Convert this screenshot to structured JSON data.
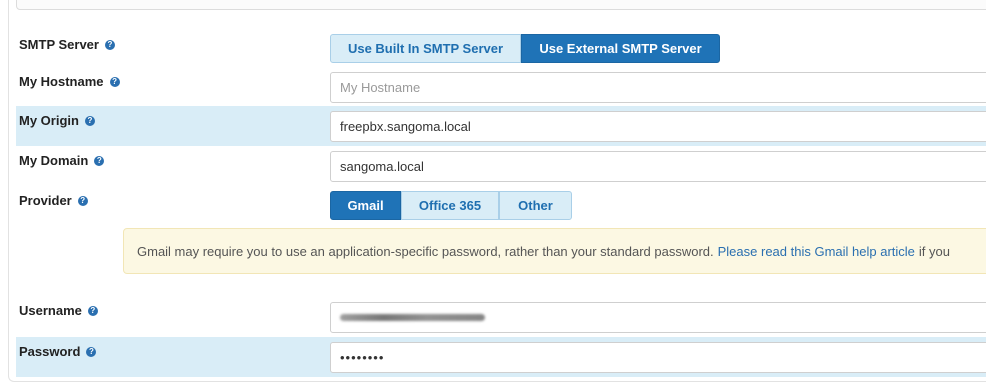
{
  "form": {
    "smtp_server": {
      "label": "SMTP Server",
      "options": [
        "Use Built In SMTP Server",
        "Use External SMTP Server"
      ],
      "selected": "Use External SMTP Server"
    },
    "hostname": {
      "label": "My Hostname",
      "value": "",
      "placeholder": "My Hostname"
    },
    "origin": {
      "label": "My Origin",
      "value": "freepbx.sangoma.local"
    },
    "domain": {
      "label": "My Domain",
      "value": "sangoma.local"
    },
    "provider": {
      "label": "Provider",
      "options": [
        "Gmail",
        "Office 365",
        "Other"
      ],
      "selected": "Gmail"
    },
    "alert": {
      "text": "Gmail may require you to use an application-specific password, rather than your standard password.",
      "link_text": "Please read this Gmail help article",
      "after_text": "if you"
    },
    "username": {
      "label": "Username",
      "value": "(redacted)"
    },
    "password": {
      "label": "Password",
      "value": "••••••••"
    }
  },
  "icons": {
    "help": "question-circle-icon"
  },
  "colors": {
    "accent": "#1f73b7",
    "highlight_row": "#d9edf7",
    "alert_bg": "#fcf8e3"
  }
}
